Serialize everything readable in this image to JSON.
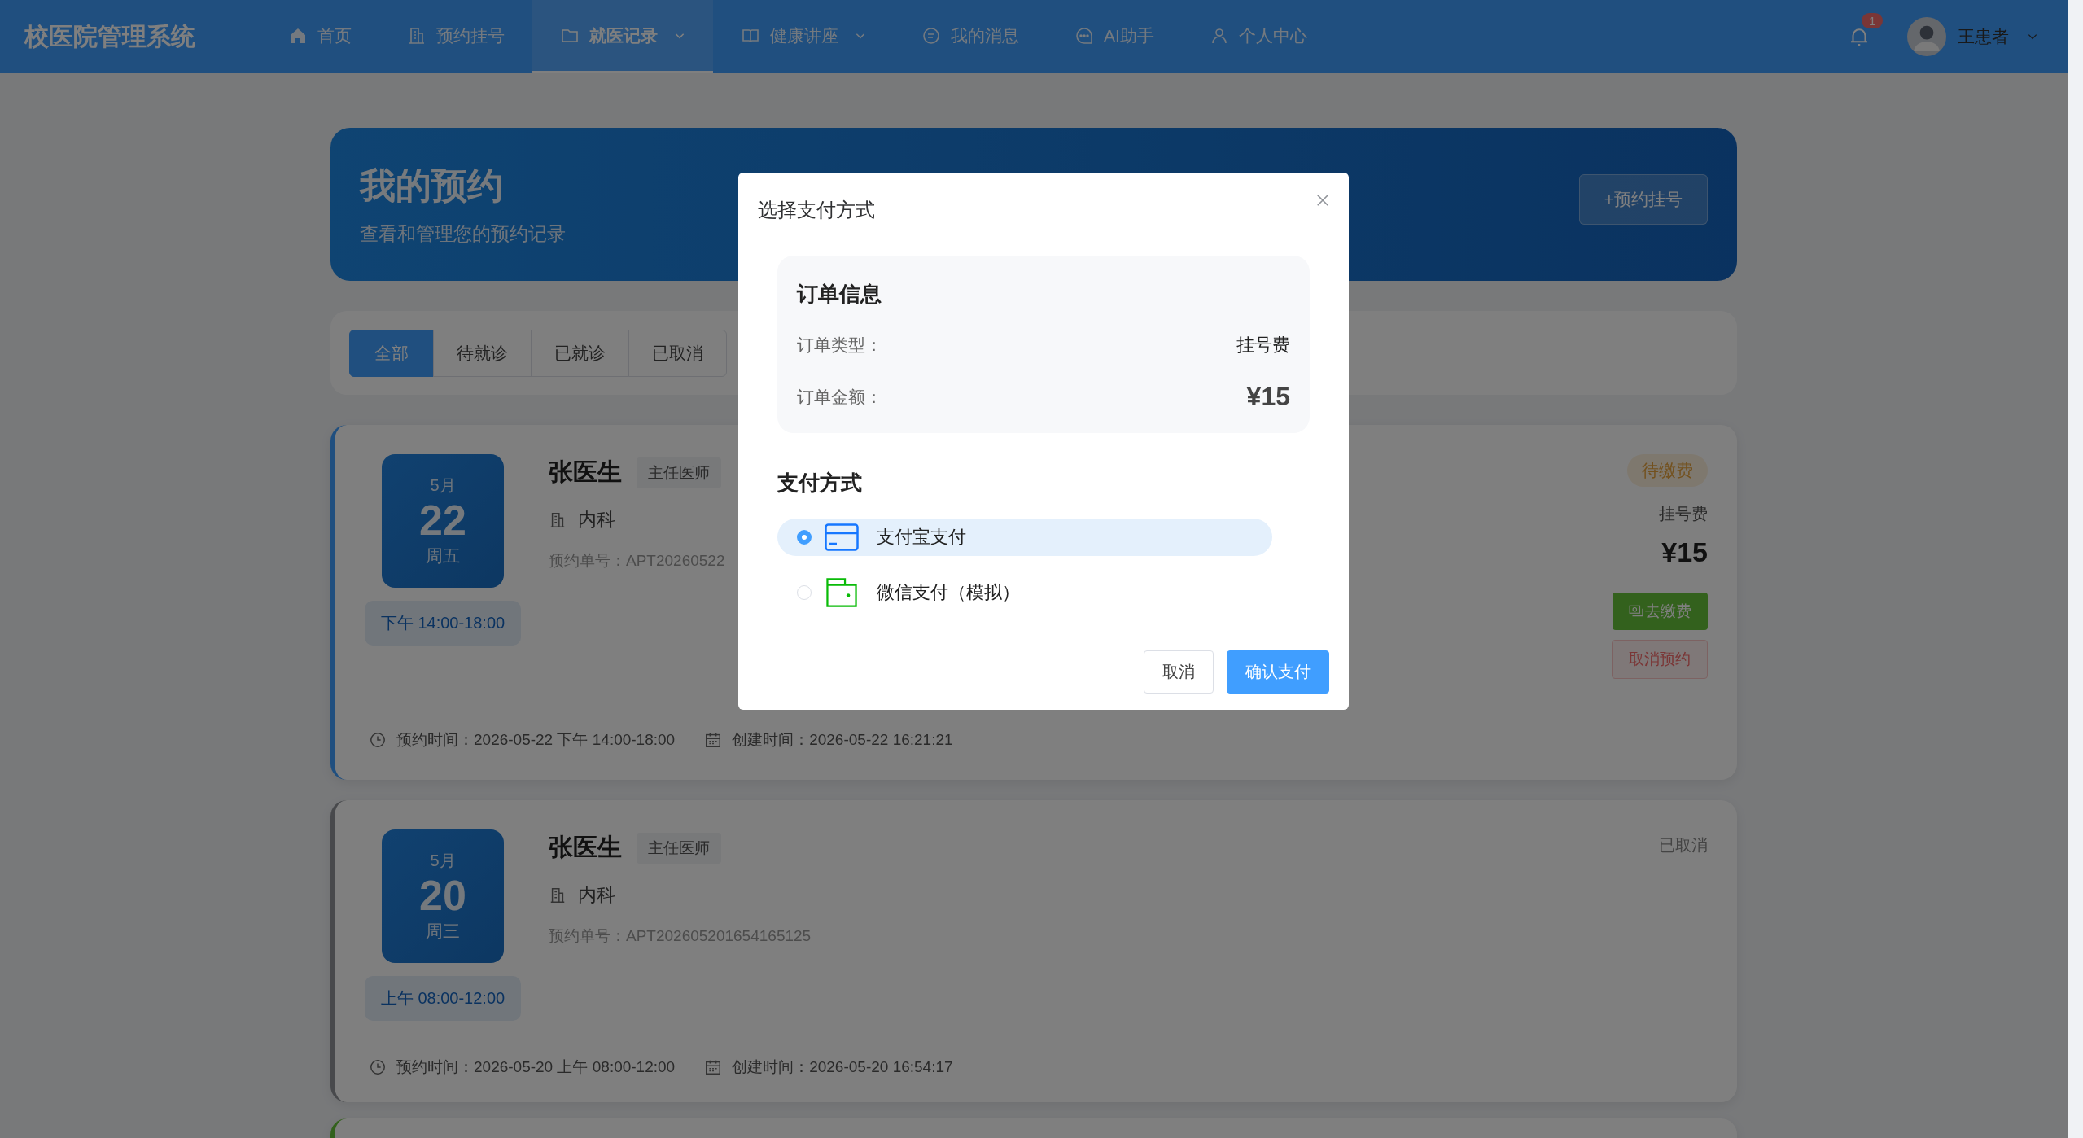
{
  "app": {
    "title": "校医院管理系统"
  },
  "nav": [
    {
      "label": "首页",
      "kind": "home",
      "selected": false,
      "dropdown": false
    },
    {
      "label": "预约挂号",
      "kind": "building",
      "selected": false,
      "dropdown": false
    },
    {
      "label": "就医记录",
      "kind": "folder",
      "selected": true,
      "dropdown": true
    },
    {
      "label": "健康讲座",
      "kind": "book",
      "selected": false,
      "dropdown": true
    },
    {
      "label": "我的消息",
      "kind": "chat",
      "selected": false,
      "dropdown": false
    },
    {
      "label": "AI助手",
      "kind": "dots",
      "selected": false,
      "dropdown": false
    },
    {
      "label": "个人中心",
      "kind": "user",
      "selected": false,
      "dropdown": false
    }
  ],
  "notifications": {
    "count": "1"
  },
  "user": {
    "name": "王患者"
  },
  "banner": {
    "title": "我的预约",
    "subtitle": "查看和管理您的预约记录",
    "action": "+预约挂号"
  },
  "filters": [
    {
      "label": "全部",
      "selected": true
    },
    {
      "label": "待就诊",
      "selected": false
    },
    {
      "label": "已就诊",
      "selected": false
    },
    {
      "label": "已取消",
      "selected": false
    }
  ],
  "appointments": [
    {
      "kind": "pending",
      "month": "5月",
      "day": "22",
      "weekday": "周五",
      "slot": "下午 14:00-18:00",
      "doctor": "张医生",
      "title": "主任医师",
      "dept": "内科",
      "order_no": "预约单号：APT20260522",
      "booked": "预约时间：2026-05-22 下午 14:00-18:00",
      "created": "创建时间：2026-05-22 16:21:21",
      "status": "待缴费",
      "fee_type": "挂号费",
      "fee": "¥15",
      "actions": [
        {
          "label": "去缴费",
          "kind": "pay"
        },
        {
          "label": "取消预约",
          "kind": "cancel"
        }
      ]
    },
    {
      "kind": "cancelled",
      "month": "5月",
      "day": "20",
      "weekday": "周三",
      "slot": "上午 08:00-12:00",
      "doctor": "张医生",
      "title": "主任医师",
      "dept": "内科",
      "order_no": "预约单号：APT202605201654165125",
      "booked": "预约时间：2026-05-20 上午 08:00-12:00",
      "created": "创建时间：2026-05-20 16:54:17",
      "status": "已取消"
    },
    {
      "kind": "done"
    }
  ],
  "dialog": {
    "title": "选择支付方式",
    "order_heading": "订单信息",
    "rows": [
      {
        "label": "订单类型：",
        "value": "挂号费",
        "kind": "text"
      },
      {
        "label": "订单金额：",
        "value": "¥15",
        "kind": "amount"
      }
    ],
    "method_heading": "支付方式",
    "methods": [
      {
        "label": "支付宝支付",
        "kind": "card",
        "selected": true
      },
      {
        "label": "微信支付（模拟）",
        "kind": "wallet",
        "selected": false
      }
    ],
    "buttons": [
      {
        "label": "取消",
        "kind": "secondary"
      },
      {
        "label": "确认支付",
        "kind": "primary"
      }
    ]
  }
}
